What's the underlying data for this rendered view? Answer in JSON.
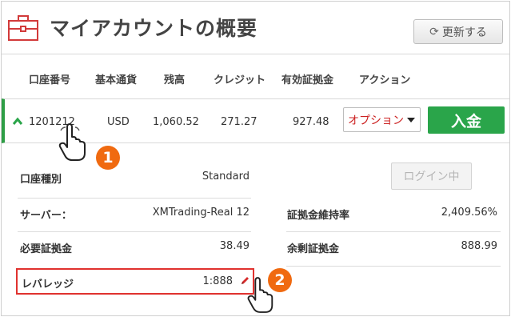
{
  "header": {
    "title": "マイアカウントの概要",
    "refresh_label": "更新する"
  },
  "columns": [
    "口座番号",
    "基本通貨",
    "残高",
    "クレジット",
    "有効証拠金",
    "アクション"
  ],
  "account": {
    "number": "1201212",
    "currency": "USD",
    "balance": "1,060.52",
    "credit": "271.27",
    "equity": "927.48",
    "options_label": "オプション",
    "deposit_label": "入金"
  },
  "details": {
    "account_type_label": "口座種別",
    "account_type_value": "Standard",
    "login_label": "ログイン中",
    "server_label": "サーバー：",
    "server_value": "XMTrading-Real 12",
    "margin_level_label": "証拠金維持率",
    "margin_level_value": "2,409.56%",
    "required_margin_label": "必要証拠金",
    "required_margin_value": "38.49",
    "free_margin_label": "余剰証拠金",
    "free_margin_value": "888.99",
    "leverage_label": "レバレッジ",
    "leverage_value": "1:888"
  },
  "annotations": {
    "step1": "1",
    "step2": "2"
  },
  "colors": {
    "accent_green": "#2aa54a",
    "accent_red": "#e0322f",
    "badge_orange": "#f06a10"
  },
  "icons": [
    "briefcase-icon",
    "refresh-icon",
    "chevron-up-icon",
    "caret-down-icon",
    "pencil-icon",
    "pointer-hand-icon"
  ]
}
